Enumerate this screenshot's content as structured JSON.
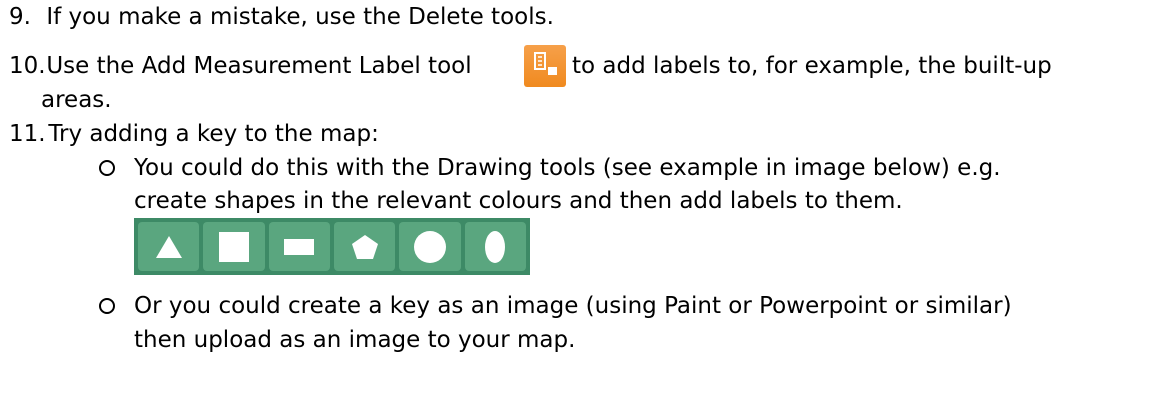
{
  "steps": [
    {
      "number": "9.",
      "text": "If you make a mistake, use the Delete tools."
    },
    {
      "number": "10.",
      "text_before": "Use the Add Measurement Label tool",
      "text_after": "to add labels to, for example, the built-up",
      "continuation": "areas."
    },
    {
      "number": "11.",
      "text": "Try adding a key to the map:"
    }
  ],
  "bullets": [
    {
      "marker": "o",
      "lines": [
        "You could do this with the Drawing tools (see example in image below) e.g.",
        "create shapes in the relevant colours and then add labels to them."
      ]
    },
    {
      "marker": "o",
      "lines": [
        "Or you could create a key as an image (using Paint or Powerpoint or similar)",
        "then upload as an image to your map."
      ]
    }
  ],
  "icons": {
    "measurement_label_tool": "measurement-label-icon",
    "drawing_tools": [
      "triangle-icon",
      "square-icon",
      "rectangle-icon",
      "pentagon-icon",
      "circle-icon",
      "ellipse-icon"
    ]
  },
  "colors": {
    "measurement_icon_bg": "#f08a1f",
    "toolbar_bg": "#3d8a66",
    "tool_bg": "#5aa67f",
    "shape_fill": "#ffffff"
  }
}
